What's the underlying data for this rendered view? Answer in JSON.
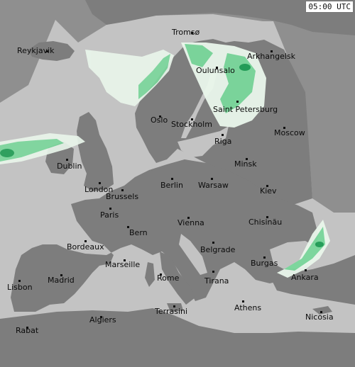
{
  "timestamp": "05:00 UTC",
  "colors": {
    "land": "#7d7d7d",
    "sea": "#c3c3c3",
    "outside": "#8f8f8f",
    "precip_light": "#eaf7ec",
    "precip_mid": "#7ad89c",
    "precip_heavy": "#1f9d55"
  },
  "cities": [
    {
      "id": "tromso",
      "name": "Tromsø"
    },
    {
      "id": "reykjavik",
      "name": "Reykjavik"
    },
    {
      "id": "arkhangelsk",
      "name": "Arkhangelsk"
    },
    {
      "id": "oulu",
      "name": "Oulunsalo"
    },
    {
      "id": "oslo",
      "name": "Oslo"
    },
    {
      "id": "stockholm",
      "name": "Stockholm"
    },
    {
      "id": "st-petersburg",
      "name": "Saint Petersburg"
    },
    {
      "id": "moscow",
      "name": "Moscow"
    },
    {
      "id": "riga",
      "name": "Riga"
    },
    {
      "id": "minsk",
      "name": "Minsk"
    },
    {
      "id": "dublin",
      "name": "Dublin"
    },
    {
      "id": "london",
      "name": "London"
    },
    {
      "id": "brussels",
      "name": "Brussels"
    },
    {
      "id": "berlin",
      "name": "Berlin"
    },
    {
      "id": "warsaw",
      "name": "Warsaw"
    },
    {
      "id": "kiev",
      "name": "Kiev"
    },
    {
      "id": "paris",
      "name": "Paris"
    },
    {
      "id": "chisinau",
      "name": "Chisinău"
    },
    {
      "id": "bern",
      "name": "Bern"
    },
    {
      "id": "vienna",
      "name": "Vienna"
    },
    {
      "id": "bordeaux",
      "name": "Bordeaux"
    },
    {
      "id": "belgrade",
      "name": "Belgrade"
    },
    {
      "id": "marseille",
      "name": "Marseille"
    },
    {
      "id": "burgas",
      "name": "Burgas"
    },
    {
      "id": "lisbon",
      "name": "Lisbon"
    },
    {
      "id": "madrid",
      "name": "Madrid"
    },
    {
      "id": "rome",
      "name": "Rome"
    },
    {
      "id": "tirana",
      "name": "Tirana"
    },
    {
      "id": "ankara",
      "name": "Ankara"
    },
    {
      "id": "athens",
      "name": "Athens"
    },
    {
      "id": "terrasini",
      "name": "Terrasini"
    },
    {
      "id": "nicosia",
      "name": "Nicosia"
    },
    {
      "id": "algiers",
      "name": "Algiers"
    },
    {
      "id": "rabat",
      "name": "Rabat"
    }
  ]
}
